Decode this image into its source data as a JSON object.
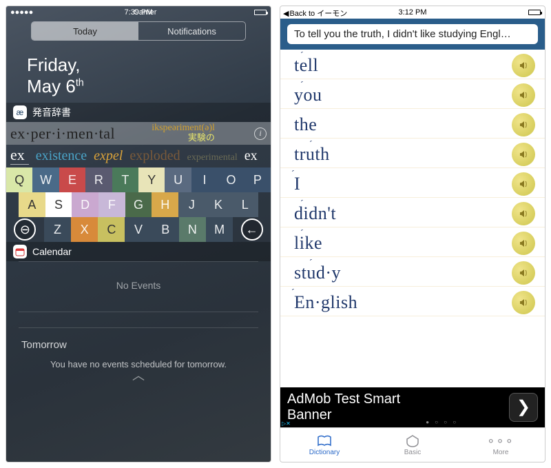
{
  "left": {
    "status": {
      "carrier": "Carrier",
      "signal": "●●●●●",
      "wifi": "▲",
      "time": "7:39 PM",
      "battery_pct": 100
    },
    "tabs": {
      "today": "Today",
      "notifications": "Notifications"
    },
    "date": {
      "weekday": "Friday,",
      "month_day": "May 6",
      "ordinal": "th"
    },
    "dict_widget": {
      "title": "発音辞書",
      "icon_text": "æ",
      "headword": "ex·per·i·men·tal",
      "phonetic": "ikspeəriment(ə)l",
      "meaning_jp": "実験の",
      "info": "i",
      "input_prefix": "ex",
      "suggestions": [
        {
          "text": "existence",
          "color": "#4aa3c7"
        },
        {
          "text": "expel",
          "color": "#d9a23a",
          "italic": true
        },
        {
          "text": "exploded",
          "color": "#7a5a3a"
        },
        {
          "text": "experimental",
          "color": "#6b6b55"
        },
        {
          "text": "ex",
          "color": "#ffffff"
        }
      ],
      "keyboard": {
        "row1": [
          {
            "k": "Q",
            "c": "#d9e7a8"
          },
          {
            "k": "W",
            "c": "#4a6a88"
          },
          {
            "k": "E",
            "c": "#c94a4a"
          },
          {
            "k": "R",
            "c": "#5a5a70"
          },
          {
            "k": "T",
            "c": "#4a7a5a"
          },
          {
            "k": "Y",
            "c": "#e8e4b8"
          },
          {
            "k": "U",
            "c": "#5a6a80"
          },
          {
            "k": "I",
            "c": "#3a506a"
          },
          {
            "k": "O",
            "c": "#3a506a"
          },
          {
            "k": "P",
            "c": "#3a506a"
          }
        ],
        "row2": [
          {
            "k": "A",
            "c": "#e8d98a"
          },
          {
            "k": "S",
            "c": "#ffffff"
          },
          {
            "k": "D",
            "c": "#caa8d0"
          },
          {
            "k": "F",
            "c": "#c8b8d8"
          },
          {
            "k": "G",
            "c": "#4a6a4a"
          },
          {
            "k": "H",
            "c": "#d8a84a"
          },
          {
            "k": "J",
            "c": "#4a5a6a"
          },
          {
            "k": "K",
            "c": "#4a5a6a"
          },
          {
            "k": "L",
            "c": "#4a5a6a"
          }
        ],
        "row3": [
          {
            "k": "⊖",
            "c": "#3a4a5a"
          },
          {
            "k": "Z",
            "c": "#3a4a5a"
          },
          {
            "k": "X",
            "c": "#d88a3a"
          },
          {
            "k": "C",
            "c": "#c8c060"
          },
          {
            "k": "V",
            "c": "#3a4a5a"
          },
          {
            "k": "B",
            "c": "#3a4a5a"
          },
          {
            "k": "N",
            "c": "#5a7a6a"
          },
          {
            "k": "M",
            "c": "#3a4a5a"
          },
          {
            "k": "←",
            "c": "#3a4a5a"
          }
        ]
      }
    },
    "calendar_widget": {
      "title": "Calendar",
      "no_events": "No Events",
      "tomorrow_header": "Tomorrow",
      "tomorrow_text": "You have no events scheduled for tomorrow."
    }
  },
  "right": {
    "status": {
      "back_label": "Back to イーモン",
      "time": "3:12 PM"
    },
    "search_text": "To tell you the truth, I didn't like studying Engl…",
    "words": [
      {
        "display": "tell",
        "stress_at": 1
      },
      {
        "display": "you",
        "stress_at": 1
      },
      {
        "display": "the",
        "stress_at": null
      },
      {
        "display": "truth",
        "stress_at": 2
      },
      {
        "display": "I",
        "stress_at": 0
      },
      {
        "display": "didn't",
        "stress_at": 1
      },
      {
        "display": "like",
        "stress_at": 1
      },
      {
        "display": "stud·y",
        "stress_at": 2
      },
      {
        "display": "En·glish",
        "stress_at": 0
      }
    ],
    "ad": {
      "line1": "AdMob Test Smart",
      "line2": "Banner",
      "tag": "▷✕"
    },
    "tabs": [
      {
        "name": "Dictionary",
        "active": true
      },
      {
        "name": "Basic",
        "active": false
      },
      {
        "name": "More",
        "active": false
      }
    ]
  }
}
